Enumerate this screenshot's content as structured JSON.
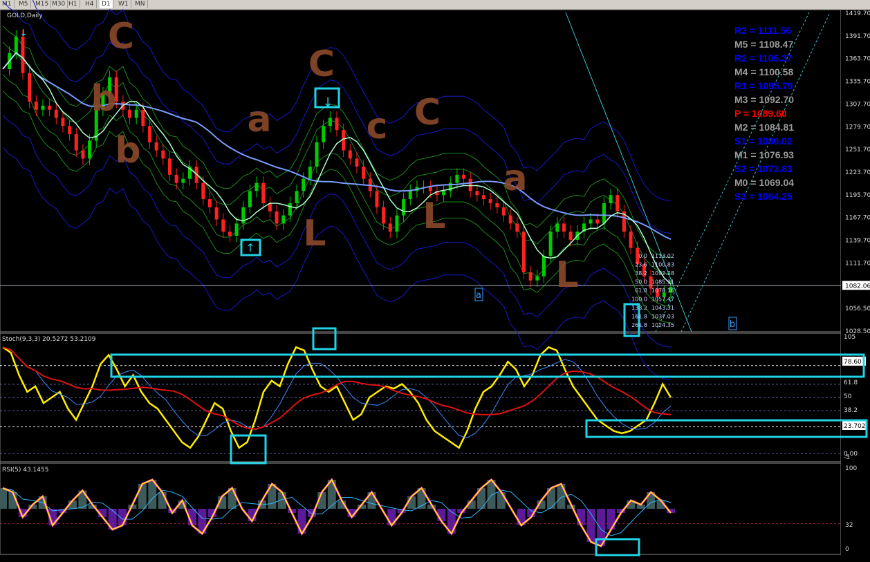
{
  "toolbar": {
    "timeframes": [
      "M1",
      "M5",
      "M15",
      "M30",
      "H1",
      "H4",
      "D1",
      "W1",
      "MN"
    ],
    "active": "D1"
  },
  "main_panel": {
    "title": "GOLD,Daily",
    "current_price": "1082.06",
    "price_ticks": [
      "1419.70",
      "1391.70",
      "1363.70",
      "1335.70",
      "1307.70",
      "1279.70",
      "1251.70",
      "1223.70",
      "1195.70",
      "1167.70",
      "1139.70",
      "1111.70",
      "1082.06",
      "1056.50",
      "1028.50"
    ],
    "wave_marks": [
      "a",
      "b"
    ],
    "hand_letters": [
      "C",
      "b",
      "C",
      "a",
      "C",
      "L",
      "c",
      "L",
      "a",
      "L",
      "b"
    ],
    "colors": {
      "pivot_resistance": "#0000ff",
      "pivot_mid": "#9a9a9a",
      "pivot": "#ff0000",
      "annotation": "#8b4a2b",
      "highlight": "#22d3e6",
      "bull_candle": "#00cc00",
      "bear_candle": "#ff2020",
      "ma_slow": "#7a9cff",
      "ma_fast": "#b0ffd0"
    }
  },
  "pivots": [
    {
      "label": "R3 = 1111.56",
      "level": "resistance"
    },
    {
      "label": "M5 = 1108.47",
      "level": "mid"
    },
    {
      "label": "R2 = 1105.37",
      "level": "resistance"
    },
    {
      "label": "M4 = 1100.58",
      "level": "mid"
    },
    {
      "label": "R1 = 1095.79",
      "level": "resistance"
    },
    {
      "label": "M3 = 1092.70",
      "level": "mid"
    },
    {
      "label": "P = 1089.60",
      "level": "pivot"
    },
    {
      "label": "M2 = 1084.81",
      "level": "mid"
    },
    {
      "label": "S1 = 1080.02",
      "level": "resistance"
    },
    {
      "label": "M1 = 1076.93",
      "level": "mid"
    },
    {
      "label": "S2 = 1073.83",
      "level": "resistance"
    },
    {
      "label": "M0 = 1069.04",
      "level": "mid"
    },
    {
      "label": "S3 = 1064.25",
      "level": "resistance"
    }
  ],
  "fibs": [
    {
      "ratio": "0.0",
      "price": "1113.02"
    },
    {
      "ratio": "23.6",
      "price": "1100.83"
    },
    {
      "ratio": "38.2",
      "price": "1092.28"
    },
    {
      "ratio": "50.0",
      "price": "1085.91"
    },
    {
      "ratio": "61.8",
      "price": "1078.16"
    },
    {
      "ratio": "100.0",
      "price": "1057.47"
    },
    {
      "ratio": "138.2",
      "price": "1043.31"
    },
    {
      "ratio": "161.8",
      "price": "1037.03"
    },
    {
      "ratio": "261.8",
      "price": "1024.35"
    }
  ],
  "stoch_panel": {
    "header": "Stoch(9,3,3) 20.5272 53.2109",
    "ticks": [
      "105",
      "78.60",
      "61.8",
      "50",
      "38.2",
      "23.702",
      "0.00",
      "-5"
    ]
  },
  "rsi_panel": {
    "header": "RSI(5) 43.1455",
    "ticks": [
      "100",
      "32",
      "0"
    ]
  },
  "chart_data": [
    {
      "type": "line",
      "name": "GOLD Daily candles (close, approx.)",
      "title": "GOLD,Daily",
      "ylim": [
        1028.5,
        1419.7
      ],
      "y": [
        1350,
        1370,
        1390,
        1345,
        1310,
        1300,
        1305,
        1300,
        1290,
        1280,
        1270,
        1250,
        1240,
        1262,
        1300,
        1320,
        1340,
        1310,
        1300,
        1290,
        1300,
        1280,
        1260,
        1250,
        1240,
        1220,
        1210,
        1215,
        1230,
        1210,
        1190,
        1180,
        1165,
        1150,
        1145,
        1160,
        1180,
        1200,
        1210,
        1185,
        1175,
        1160,
        1170,
        1185,
        1200,
        1215,
        1230,
        1260,
        1280,
        1290,
        1275,
        1250,
        1240,
        1230,
        1215,
        1200,
        1180,
        1160,
        1150,
        1170,
        1190,
        1200,
        1205,
        1205,
        1200,
        1195,
        1200,
        1210,
        1220,
        1215,
        1200,
        1195,
        1190,
        1185,
        1180,
        1170,
        1160,
        1150,
        1100,
        1090,
        1095,
        1120,
        1150,
        1160,
        1150,
        1140,
        1150,
        1160,
        1165,
        1160,
        1185,
        1195,
        1175,
        1150,
        1130,
        1110,
        1095,
        1080,
        1070,
        1075,
        1082
      ]
    },
    {
      "type": "line",
      "name": "Stochastic",
      "ylim": [
        -5,
        105
      ],
      "y": [
        95,
        90,
        70,
        55,
        60,
        45,
        50,
        55,
        40,
        30,
        45,
        60,
        80,
        88,
        75,
        60,
        70,
        55,
        45,
        40,
        30,
        20,
        10,
        5,
        15,
        30,
        45,
        40,
        20,
        5,
        10,
        30,
        55,
        65,
        60,
        80,
        95,
        92,
        75,
        60,
        55,
        60,
        45,
        30,
        35,
        50,
        55,
        60,
        58,
        62,
        55,
        45,
        30,
        20,
        15,
        10,
        5,
        20,
        40,
        55,
        60,
        70,
        82,
        75,
        60,
        70,
        88,
        95,
        92,
        75,
        60,
        50,
        40,
        30,
        25,
        20,
        18,
        20,
        25,
        30,
        45,
        62,
        50
      ]
    },
    {
      "type": "line",
      "name": "RSI(5)",
      "ylim": [
        0,
        100
      ],
      "y": [
        75,
        70,
        40,
        55,
        65,
        30,
        45,
        60,
        72,
        55,
        40,
        25,
        30,
        55,
        80,
        85,
        70,
        45,
        60,
        30,
        20,
        40,
        65,
        75,
        50,
        35,
        60,
        80,
        70,
        45,
        20,
        40,
        70,
        85,
        60,
        40,
        55,
        70,
        50,
        30,
        45,
        65,
        75,
        55,
        35,
        20,
        45,
        60,
        75,
        85,
        70,
        50,
        30,
        40,
        60,
        75,
        80,
        55,
        30,
        10,
        5,
        25,
        45,
        60,
        55,
        70,
        60,
        45
      ]
    }
  ]
}
